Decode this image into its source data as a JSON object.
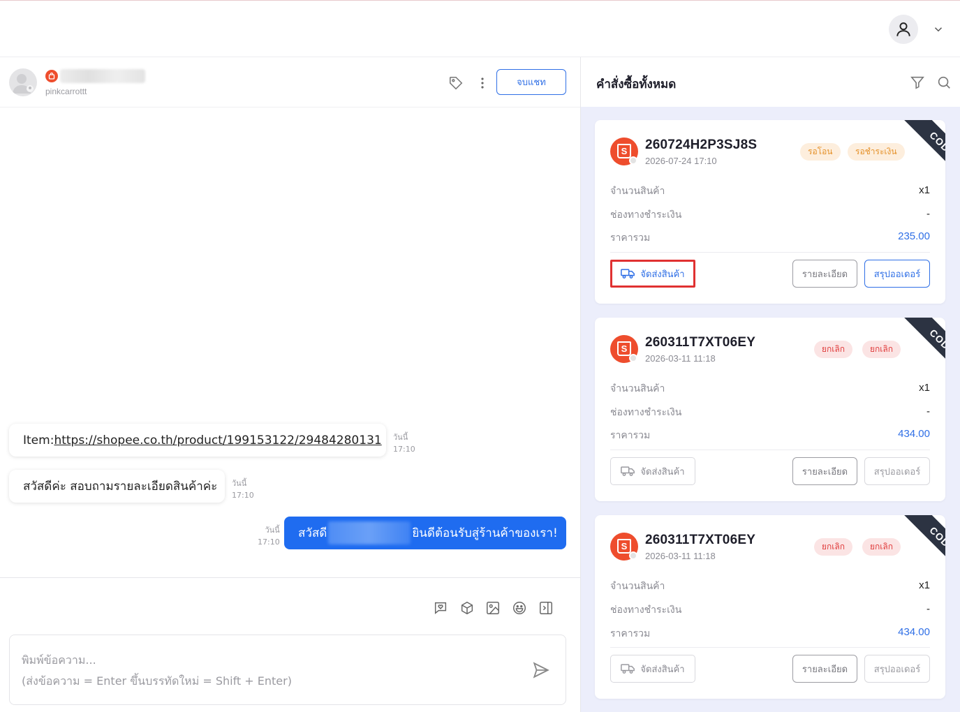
{
  "chat": {
    "customer_username": "pinkcarrottt",
    "end_chat_label": "จบแชท",
    "messages": [
      {
        "prefix": "Item: ",
        "link": "https://shopee.co.th/product/199153122/29484280131",
        "day": "วันนี้",
        "time": "17:10"
      },
      {
        "text": "สวัสดีค่ะ สอบถามรายละเอียดสินค้าค่ะ",
        "day": "วันนี้",
        "time": "17:10"
      }
    ],
    "outgoing": {
      "greeting": "สวัสดี",
      "rest": "ยินดีต้อนรับสู่ร้านค้าของเรา!",
      "day": "วันนี้",
      "time": "17:10"
    },
    "composer": {
      "placeholder_line1": "พิมพ์ข้อความ...",
      "placeholder_line2": "(ส่งข้อความ = Enter ขึ้นบรรทัดใหม่ = Shift + Enter)"
    }
  },
  "orders": {
    "title": "คำสั่งซื้อทั้งหมด",
    "labels": {
      "quantity": "จำนวนสินค้า",
      "payment": "ช่องทางชำระเงิน",
      "total": "ราคารวม"
    },
    "buttons": {
      "ship": "จัดส่งสินค้า",
      "detail": "รายละเอียด",
      "summary": "สรุปออเดอร์"
    },
    "ribbon": "COD",
    "list": [
      {
        "id": "260724H2P3SJ8S",
        "date": "2026-07-24 17:10",
        "badge1": "รอโอน",
        "badge2": "รอชำระเงิน",
        "badge_color": "orange",
        "quantity": "x1",
        "payment": "-",
        "total": "235.00"
      },
      {
        "id": "260311T7XT06EY",
        "date": "2026-03-11 11:18",
        "badge1": "ยกเลิก",
        "badge2": "ยกเลิก",
        "badge_color": "red",
        "quantity": "x1",
        "payment": "-",
        "total": "434.00"
      },
      {
        "id": "260311T7XT06EY",
        "date": "2026-03-11 11:18",
        "badge1": "ยกเลิก",
        "badge2": "ยกเลิก",
        "badge_color": "red",
        "quantity": "x1",
        "payment": "-",
        "total": "434.00"
      }
    ]
  },
  "colors": {
    "accent": "#2f6fe6",
    "shopee": "#ee4d2d",
    "ribbon": "#2c3342",
    "highlight": "#e03131"
  }
}
